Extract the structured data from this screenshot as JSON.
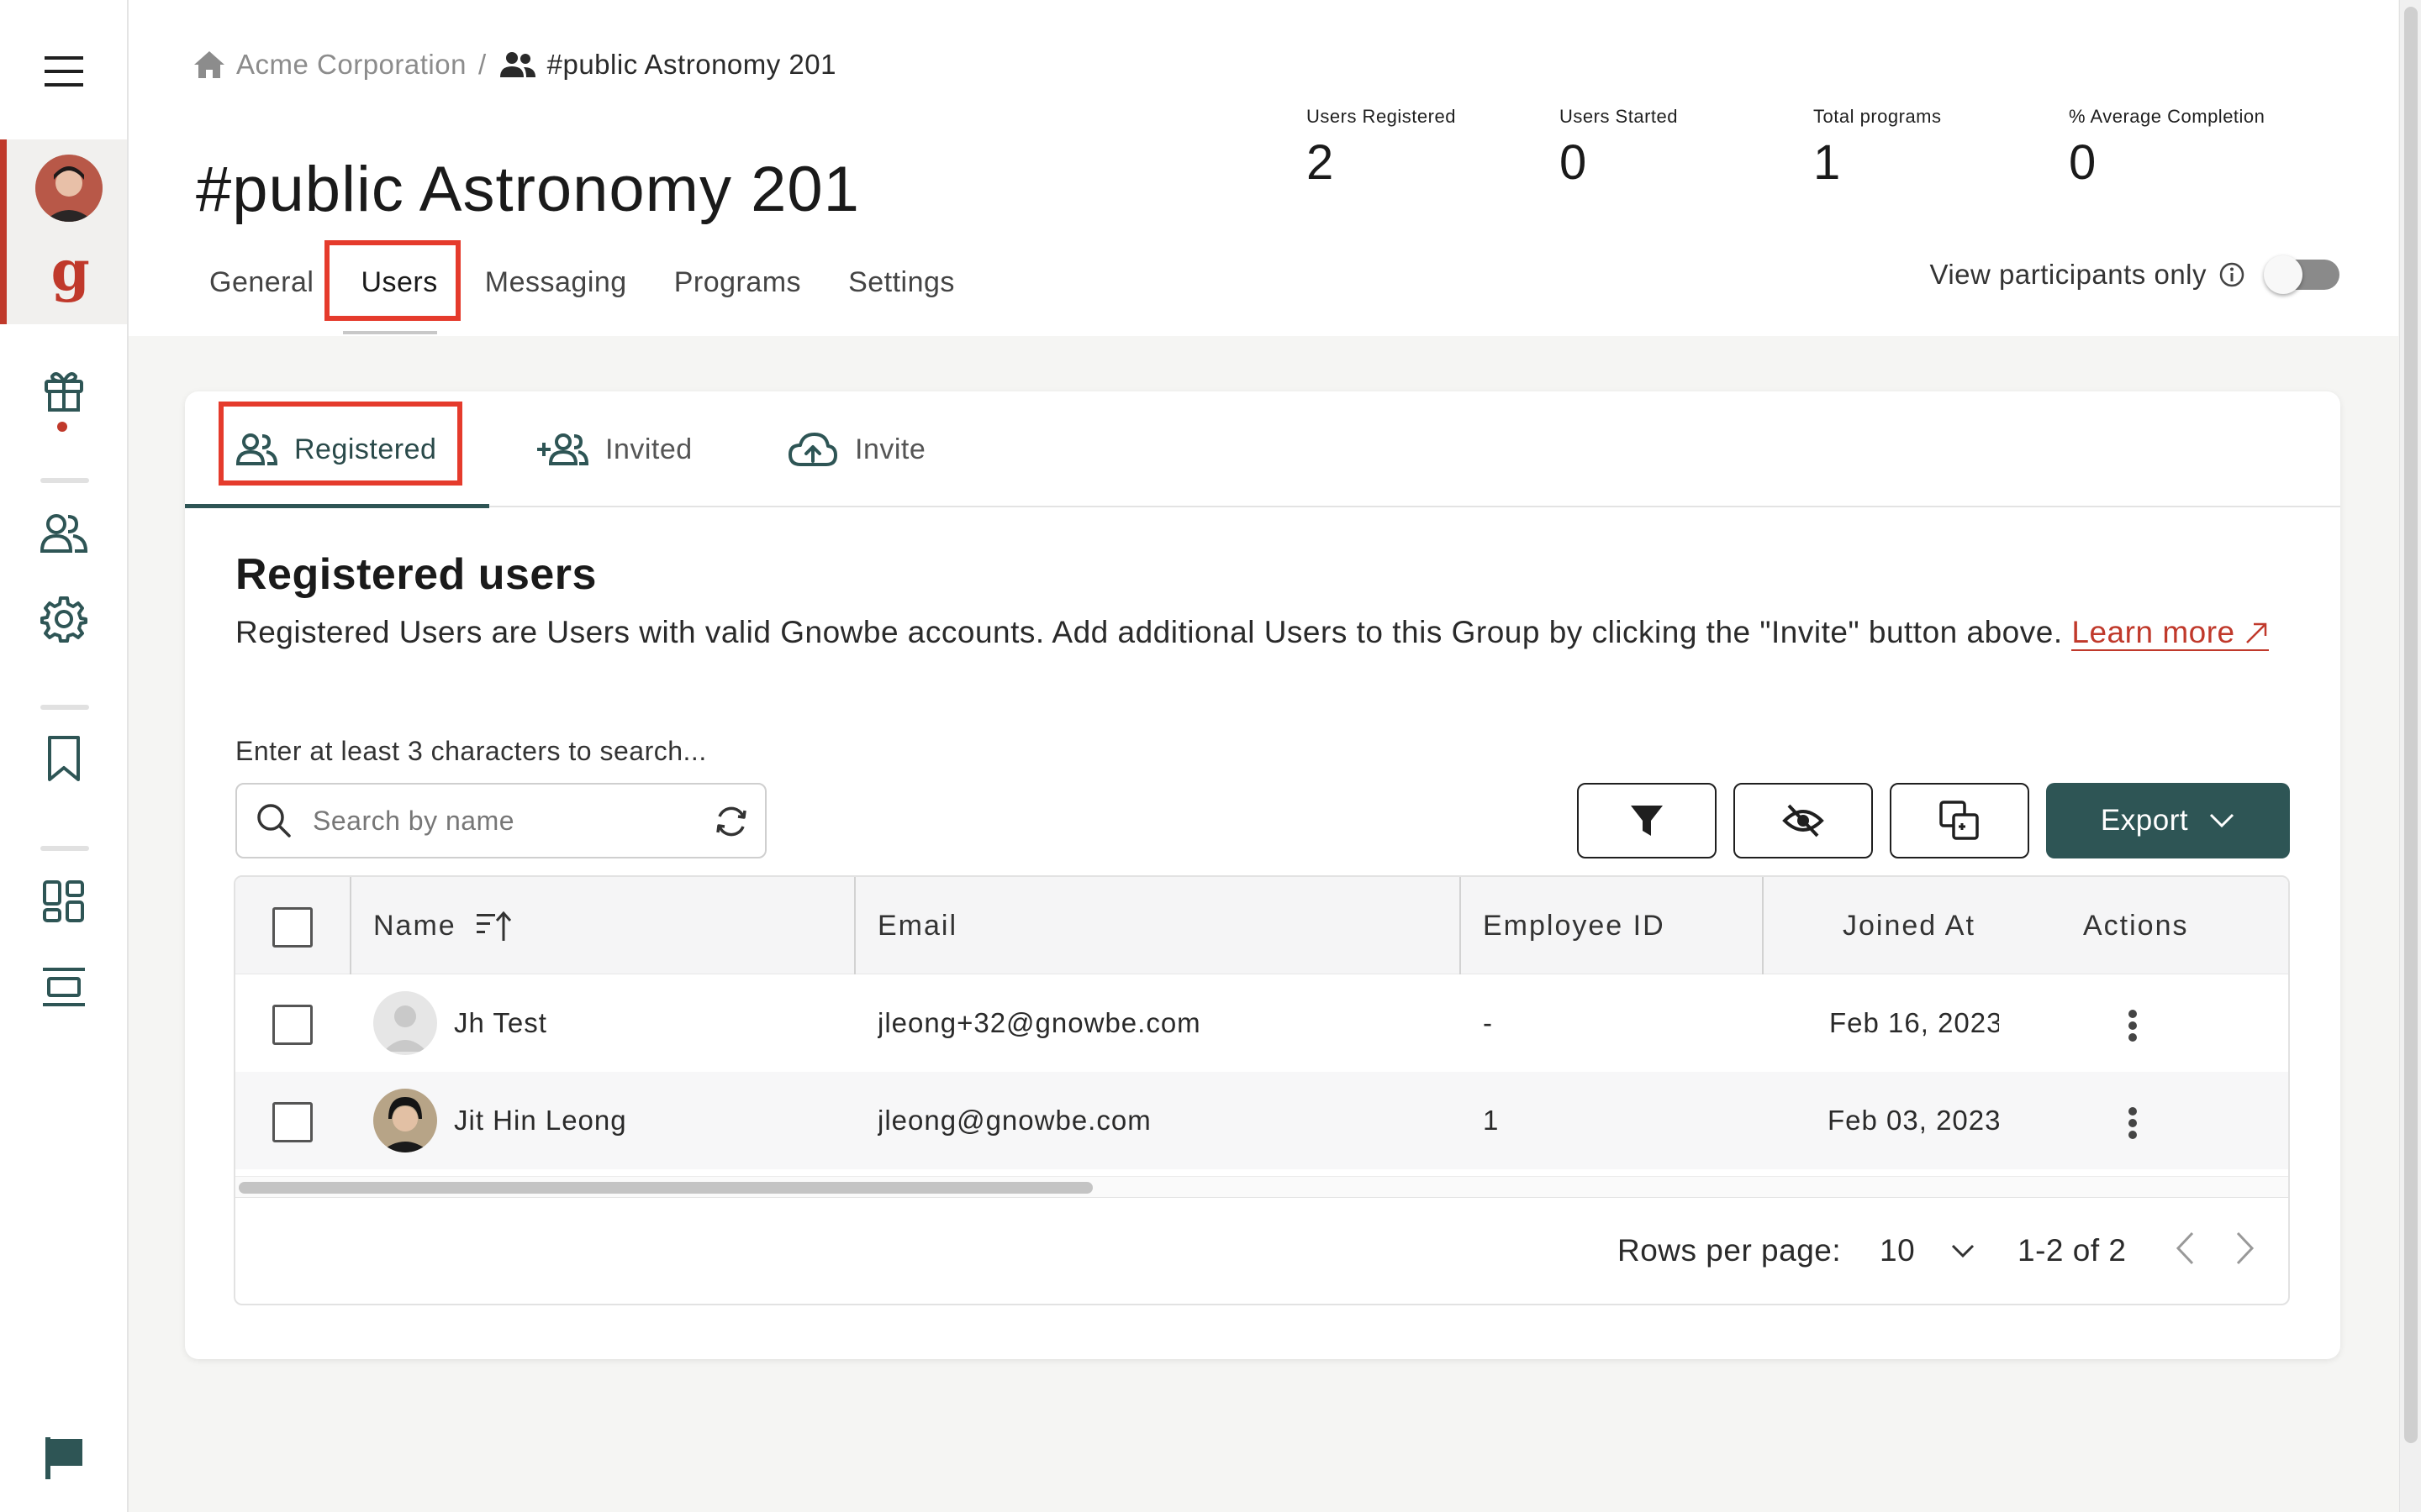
{
  "breadcrumb": {
    "org": "Acme Corporation",
    "separator": "/",
    "current": "#public Astronomy 201"
  },
  "page_title": "#public Astronomy 201",
  "stats": [
    {
      "label": "Users Registered",
      "value": "2"
    },
    {
      "label": "Users Started",
      "value": "0"
    },
    {
      "label": "Total programs",
      "value": "1"
    },
    {
      "label": "% Average Completion",
      "value": "0"
    }
  ],
  "main_tabs": [
    {
      "label": "General"
    },
    {
      "label": "Users",
      "active": true
    },
    {
      "label": "Messaging"
    },
    {
      "label": "Programs"
    },
    {
      "label": "Settings"
    }
  ],
  "participants_toggle": {
    "label": "View participants only",
    "on": false
  },
  "sub_tabs": [
    {
      "label": "Registered",
      "active": true
    },
    {
      "label": "Invited"
    },
    {
      "label": "Invite"
    }
  ],
  "section": {
    "title": "Registered users",
    "description": "Registered Users are Users with valid Gnowbe accounts. Add additional Users to this Group by clicking the \"Invite\" button above. ",
    "learn_more": "Learn more"
  },
  "search": {
    "hint": "Enter at least 3 characters to search...",
    "placeholder": "Search by name",
    "value": ""
  },
  "toolbar": {
    "export_label": "Export"
  },
  "table": {
    "columns": [
      "Name",
      "Email",
      "Employee ID",
      "Joined At",
      "Actions"
    ],
    "rows": [
      {
        "name": "Jh Test",
        "email": "jleong+32@gnowbe.com",
        "employee_id": "-",
        "joined_at": "Feb 16, 2023"
      },
      {
        "name": "Jit Hin Leong",
        "email": "jleong@gnowbe.com",
        "employee_id": "1",
        "joined_at": "Feb 03, 2023"
      }
    ]
  },
  "pagination": {
    "rows_per_page_label": "Rows per page:",
    "rows_per_page": "10",
    "range": "1-2 of 2"
  },
  "colors": {
    "accent": "#2e5555",
    "brand_red": "#c0392b",
    "highlight": "#e53b2c"
  }
}
